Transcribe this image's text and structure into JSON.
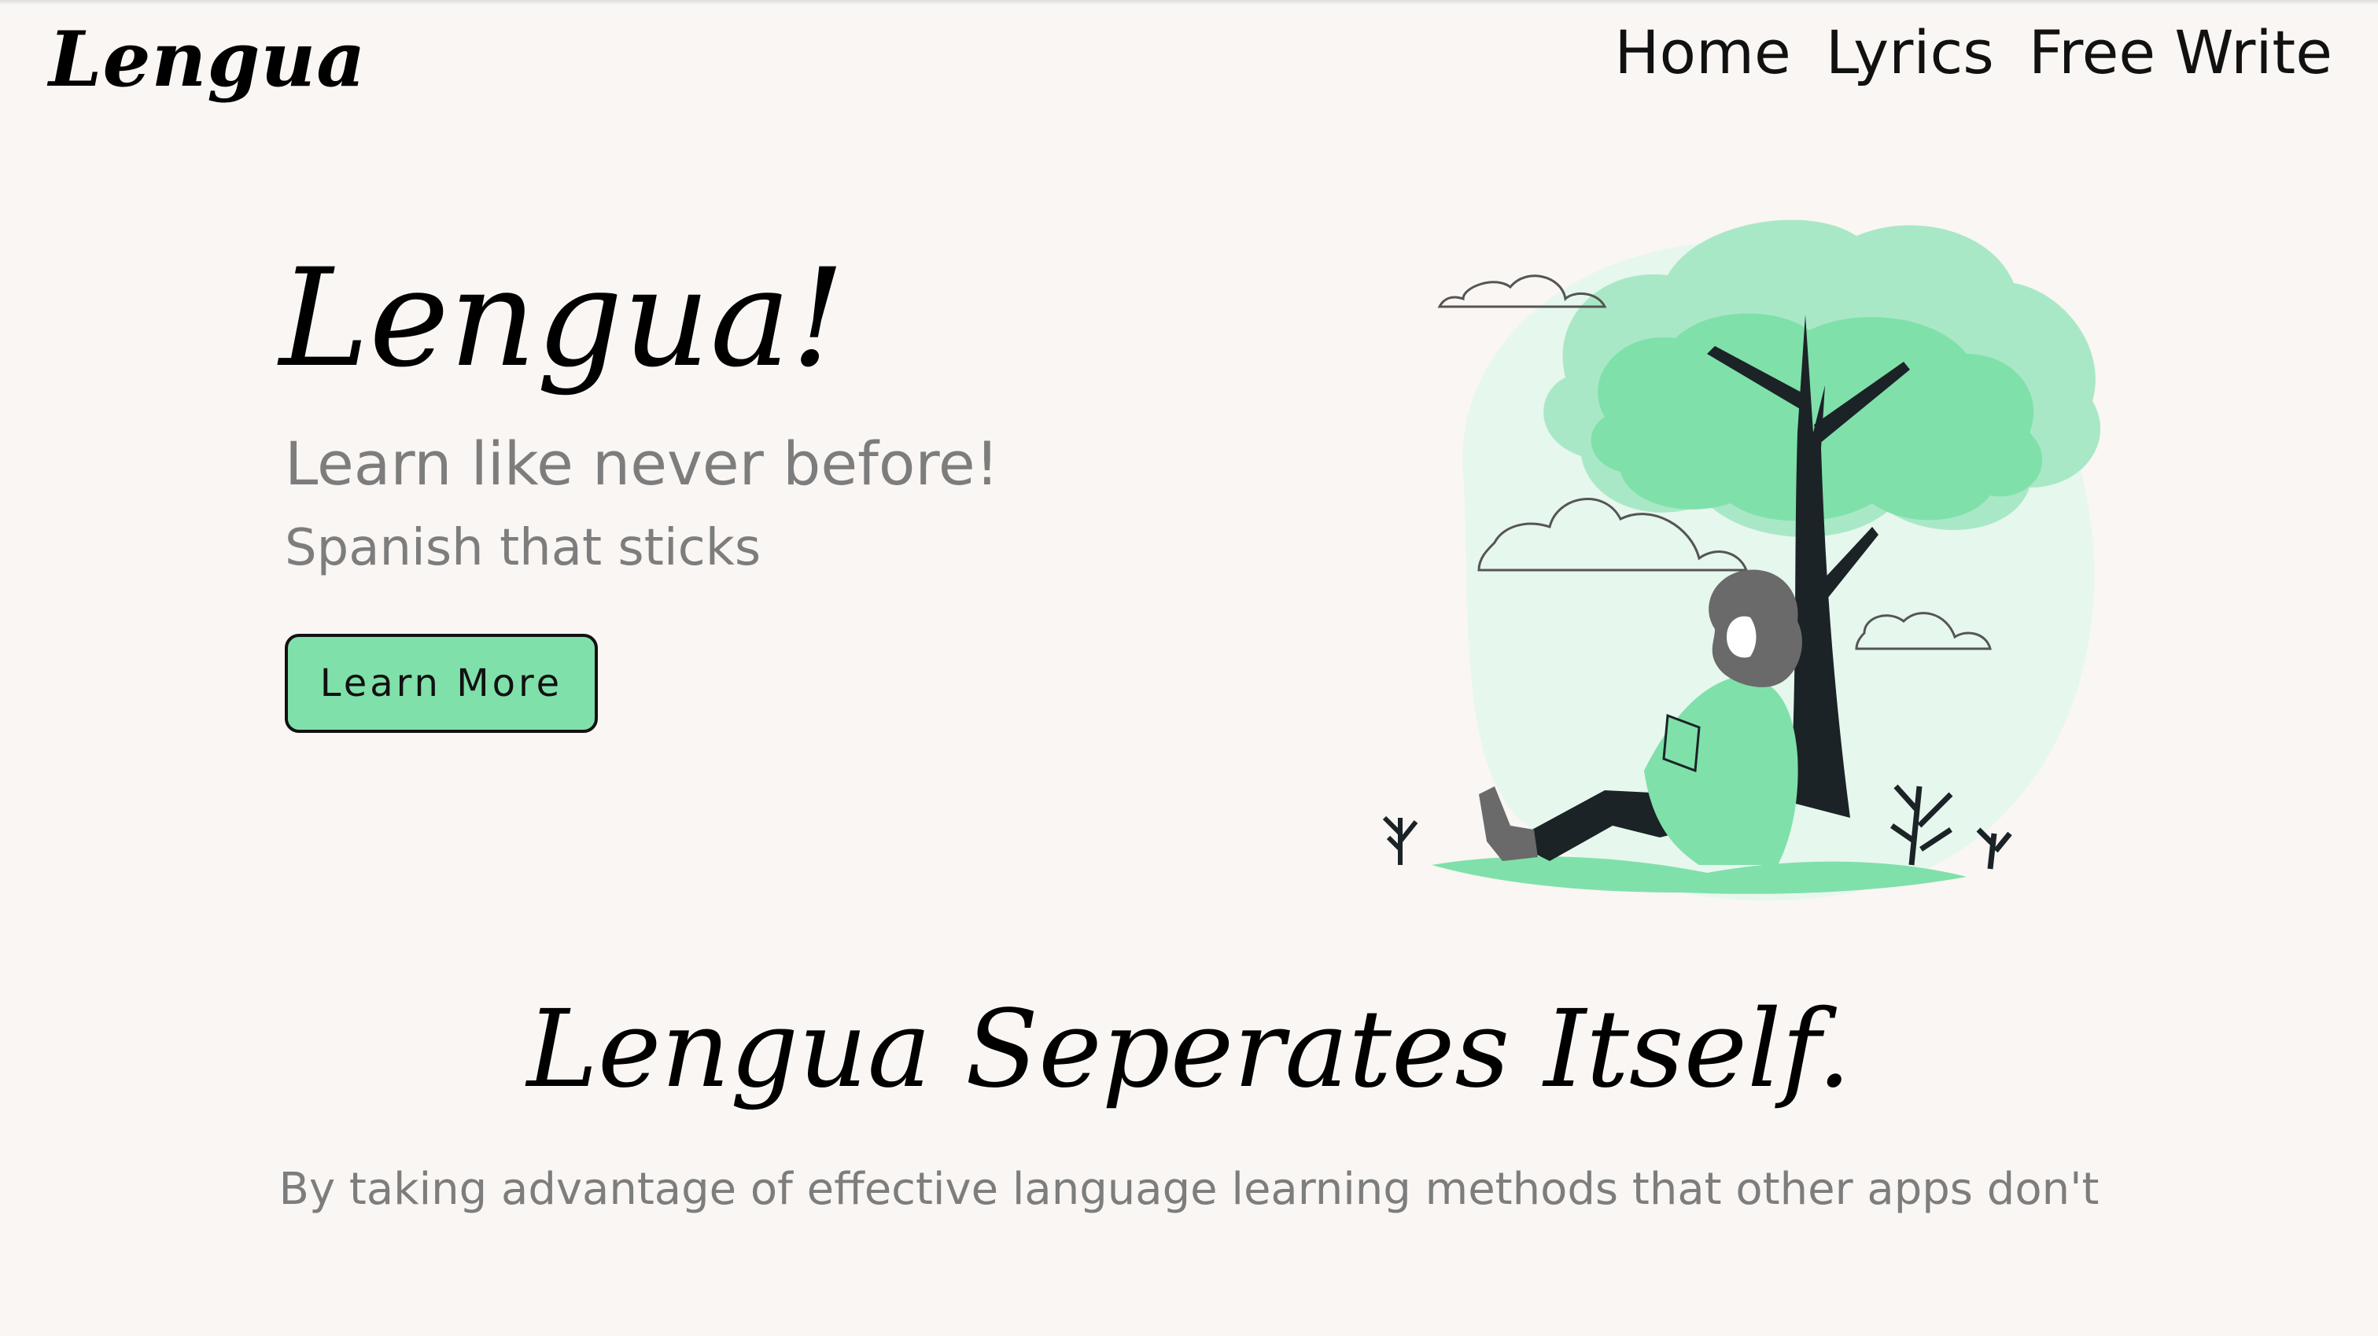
{
  "header": {
    "logo": "Lengua",
    "nav": [
      {
        "label": "Home"
      },
      {
        "label": "Lyrics"
      },
      {
        "label": "Free Write"
      }
    ]
  },
  "hero": {
    "title": "Lengua!",
    "subtitle": "Learn like never before!",
    "tagline": "Spanish that sticks",
    "cta_label": "Learn More",
    "illustration_icon": "woman-reading-under-tree-illustration"
  },
  "section": {
    "title": "Lengua Seperates Itself.",
    "description": "By taking advantage of effective language learning methods that other apps don't"
  },
  "colors": {
    "background": "#f9f6f3",
    "accent_green": "#80e0aa",
    "light_green": "#e6f7ee",
    "dark": "#1b2326",
    "muted_text": "#7d7d7d"
  }
}
